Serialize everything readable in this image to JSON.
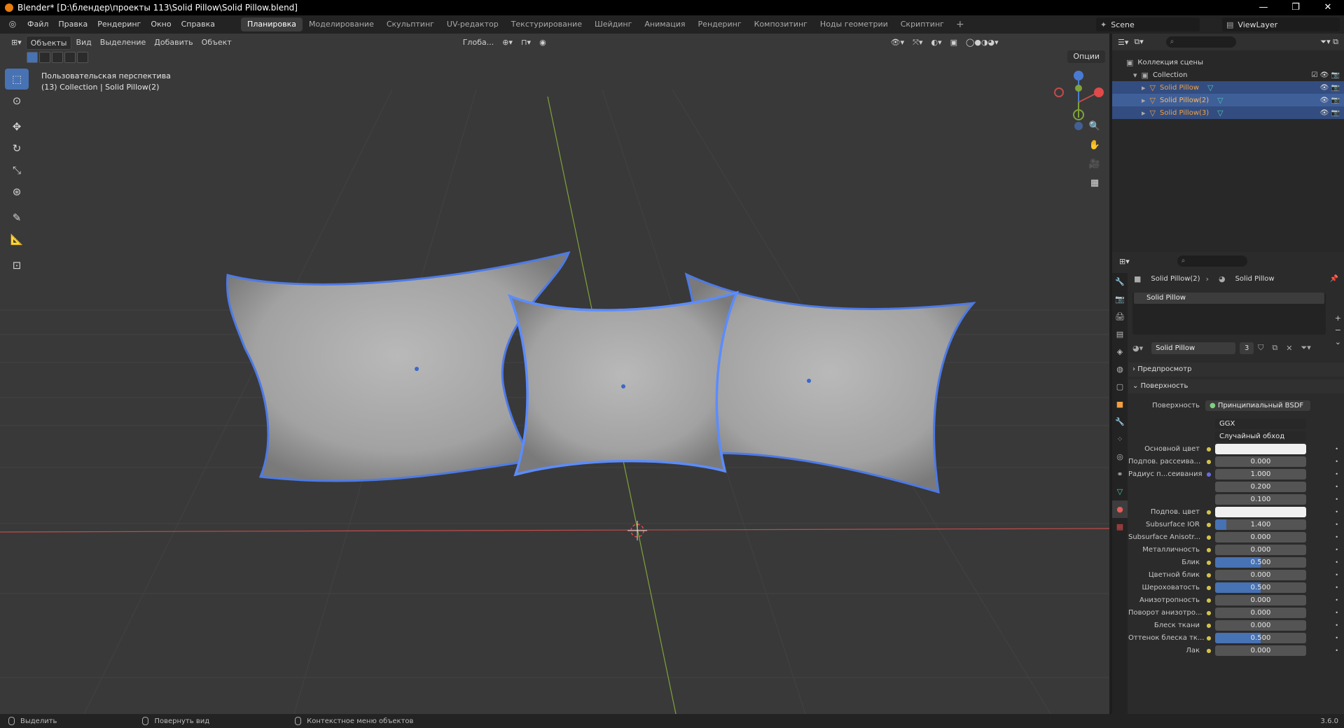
{
  "window": {
    "title": "Blender* [D:\\блендер\\проекты 113\\Solid Pillow\\Solid Pillow.blend]",
    "controls": [
      "—",
      "❐",
      "✕"
    ]
  },
  "menu": [
    "Файл",
    "Правка",
    "Рендеринг",
    "Окно",
    "Справка"
  ],
  "workspaces": [
    "Планировка",
    "Моделирование",
    "Скульптинг",
    "UV-редактор",
    "Текстурирование",
    "Шейдинг",
    "Анимация",
    "Рендеринг",
    "Композитинг",
    "Ноды геометрии",
    "Скриптинг"
  ],
  "active_workspace": "Планировка",
  "scene": "Scene",
  "view_layer": "ViewLayer",
  "viewport": {
    "mode": "Объекты",
    "menus": [
      "Вид",
      "Выделение",
      "Добавить",
      "Объект"
    ],
    "transform_orientation": "Глоба...",
    "options_label": "Опции",
    "perspective_label": "Пользовательская перспектива",
    "collection_label": "(13) Collection | Solid Pillow(2)"
  },
  "outliner": {
    "scene_collection": "Коллекция сцены",
    "collection": "Collection",
    "objects": [
      "Solid Pillow",
      "Solid Pillow(2)",
      "Solid Pillow(3)"
    ]
  },
  "properties": {
    "object_name": "Solid Pillow(2)",
    "material_name": "Solid Pillow",
    "slot_name": "Solid Pillow",
    "material_users": "3",
    "panel_preview": "Предпросмотр",
    "panel_surface": "Поверхность",
    "surface_label": "Поверхность",
    "surface_value": "Принципиальный BSDF",
    "distribution": "GGX",
    "subsurface_method": "Случайный обход",
    "rows": [
      {
        "label": "Основной цвет",
        "value": "",
        "kind": "color"
      },
      {
        "label": "Подпов. рассеива...",
        "value": "0.000",
        "fill": 0
      },
      {
        "label": "Радиус п...сеивания",
        "value": "1.000",
        "fill": 0
      },
      {
        "label": "",
        "value": "0.200",
        "fill": 0
      },
      {
        "label": "",
        "value": "0.100",
        "fill": 0
      },
      {
        "label": "Подпов. цвет",
        "value": "",
        "kind": "color"
      },
      {
        "label": "Subsurface IOR",
        "value": "1.400",
        "fill": 0.12
      },
      {
        "label": "Subsurface Anisotr...",
        "value": "0.000",
        "fill": 0
      },
      {
        "label": "Металличность",
        "value": "0.000",
        "fill": 0
      },
      {
        "label": "Блик",
        "value": "0.500",
        "fill": 0.5
      },
      {
        "label": "Цветной блик",
        "value": "0.000",
        "fill": 0
      },
      {
        "label": "Шероховатость",
        "value": "0.500",
        "fill": 0.5
      },
      {
        "label": "Анизотропность",
        "value": "0.000",
        "fill": 0
      },
      {
        "label": "Поворот анизотро...",
        "value": "0.000",
        "fill": 0
      },
      {
        "label": "Блеск ткани",
        "value": "0.000",
        "fill": 0
      },
      {
        "label": "Оттенок блеска тк...",
        "value": "0.500",
        "fill": 0.5
      },
      {
        "label": "Лак",
        "value": "0.000",
        "fill": 0
      }
    ]
  },
  "statusbar": {
    "select": "Выделить",
    "rotate": "Повернуть вид",
    "context": "Контекстное меню объектов",
    "version": "3.6.0"
  },
  "colors": {
    "accent": "#4772b3",
    "selection_outline": "#4d7ae6",
    "x_axis": "#c24b4b",
    "y_axis": "#7fa33a"
  }
}
